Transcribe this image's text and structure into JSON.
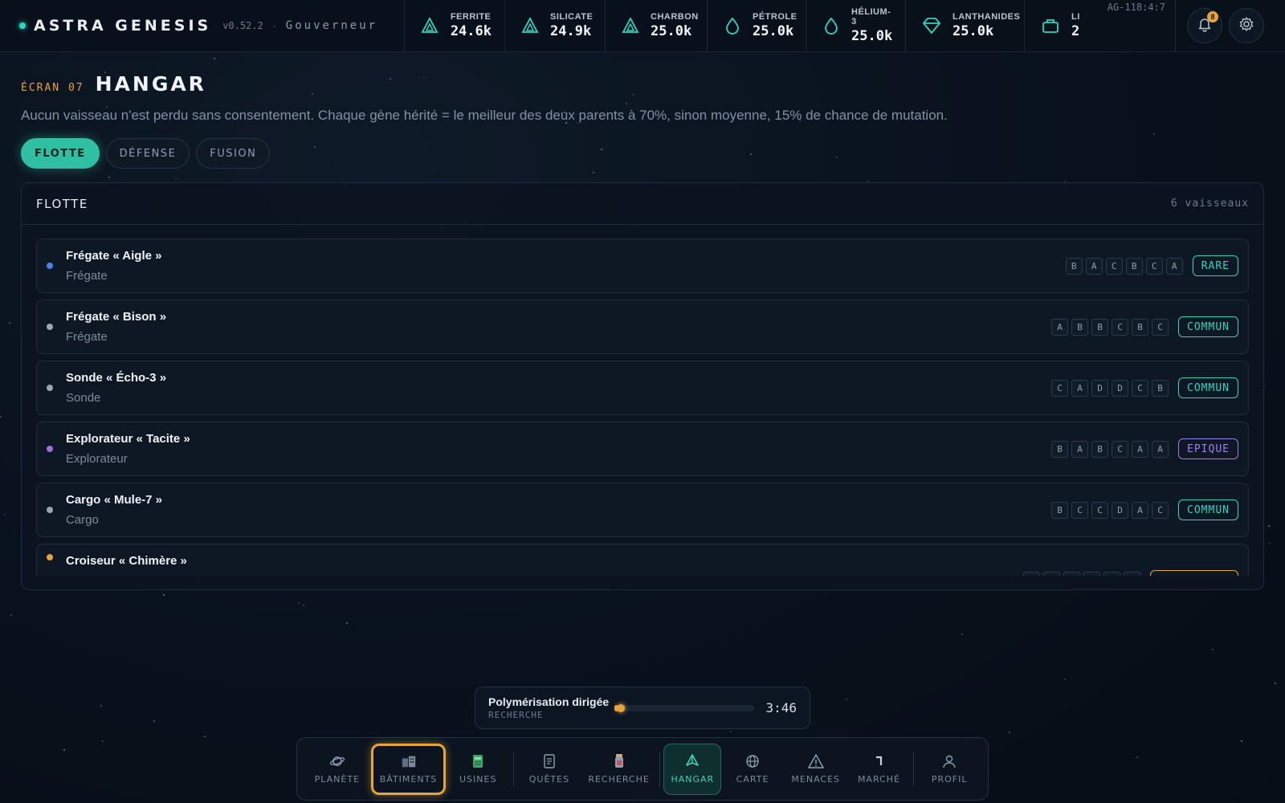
{
  "app": {
    "title": "ASTRA GENESIS",
    "version": "v0.52.2",
    "separator": "·",
    "role": "Gouverneur",
    "coords": "AG-118:4:7",
    "notification_count": "8"
  },
  "resources": [
    {
      "label": "FERRITE",
      "value": "24.6k",
      "icon": "triangle-icon"
    },
    {
      "label": "SILICATE",
      "value": "24.9k",
      "icon": "triangle-icon"
    },
    {
      "label": "CHARBON",
      "value": "25.0k",
      "icon": "triangle-icon"
    },
    {
      "label": "PÉTROLE",
      "value": "25.0k",
      "icon": "drop-icon"
    },
    {
      "label": "HÉLIUM-3",
      "value": "25.0k",
      "icon": "drop-icon"
    },
    {
      "label": "LANTHANIDES",
      "value": "25.0k",
      "icon": "gem-icon"
    },
    {
      "label": "LI",
      "value": "2",
      "icon": "box-icon"
    }
  ],
  "screen": {
    "tag": "ÉCRAN 07",
    "title": "HANGAR",
    "subtitle": "Aucun vaisseau n'est perdu sans consentement. Chaque gène hérité = le meilleur des deux parents à 70%, sinon moyenne, 15% de chance de mutation."
  },
  "tabs": [
    {
      "label": "FLOTTE",
      "active": true
    },
    {
      "label": "DÉFENSE",
      "active": false
    },
    {
      "label": "FUSION",
      "active": false
    }
  ],
  "panel": {
    "title": "FLOTTE",
    "count": "6 vaisseaux"
  },
  "ships": [
    {
      "name": "Frégate « Aigle »",
      "type": "Frégate",
      "genes": [
        "B",
        "A",
        "C",
        "B",
        "C",
        "A"
      ],
      "rarity": "RARE",
      "dot": "#4f7fe0",
      "rarity_color": "#2dd4bf"
    },
    {
      "name": "Frégate « Bison »",
      "type": "Frégate",
      "genes": [
        "A",
        "B",
        "B",
        "C",
        "B",
        "C"
      ],
      "rarity": "COMMUN",
      "dot": "#9aa6b4",
      "rarity_color": "#2dd4bf"
    },
    {
      "name": "Sonde « Écho-3 »",
      "type": "Sonde",
      "genes": [
        "C",
        "A",
        "D",
        "D",
        "C",
        "B"
      ],
      "rarity": "COMMUN",
      "dot": "#9aa6b4",
      "rarity_color": "#2dd4bf"
    },
    {
      "name": "Explorateur « Tacite »",
      "type": "Explorateur",
      "genes": [
        "B",
        "A",
        "B",
        "C",
        "A",
        "A"
      ],
      "rarity": "EPIQUE",
      "dot": "#a06ee0",
      "rarity_color": "#a07cf0"
    },
    {
      "name": "Cargo « Mule-7 »",
      "type": "Cargo",
      "genes": [
        "B",
        "C",
        "C",
        "D",
        "A",
        "C"
      ],
      "rarity": "COMMUN",
      "dot": "#9aa6b4",
      "rarity_color": "#2dd4bf"
    },
    {
      "name": "Croiseur « Chimère »",
      "type": "",
      "genes": [
        "A",
        "A",
        "A",
        "B",
        "B",
        "B"
      ],
      "rarity": "LEGENDAIRE",
      "dot": "#e8a33a",
      "rarity_color": "#e8a33a"
    }
  ],
  "research": {
    "name": "Polymérisation dirigée",
    "category": "RECHERCHE",
    "progress": 0.03,
    "time": "3:46"
  },
  "nav": [
    {
      "label": "PLANÈTE",
      "icon": "planet-icon"
    },
    {
      "label": "BÂTIMENTS",
      "icon": "buildings-icon"
    },
    {
      "label": "USINES",
      "icon": "factory-icon"
    },
    {
      "label": "QUÊTES",
      "icon": "scroll-icon"
    },
    {
      "label": "RECHERCHE",
      "icon": "flask-icon"
    },
    {
      "label": "HANGAR",
      "icon": "ship-icon"
    },
    {
      "label": "CARTE",
      "icon": "globe-icon"
    },
    {
      "label": "MENACES",
      "icon": "warning-icon"
    },
    {
      "label": "MARCHÉ",
      "icon": "market-icon"
    },
    {
      "label": "PROFIL",
      "icon": "user-icon"
    }
  ],
  "colors": {
    "accent": "#2fbfa3",
    "warning": "#e8a33a"
  }
}
